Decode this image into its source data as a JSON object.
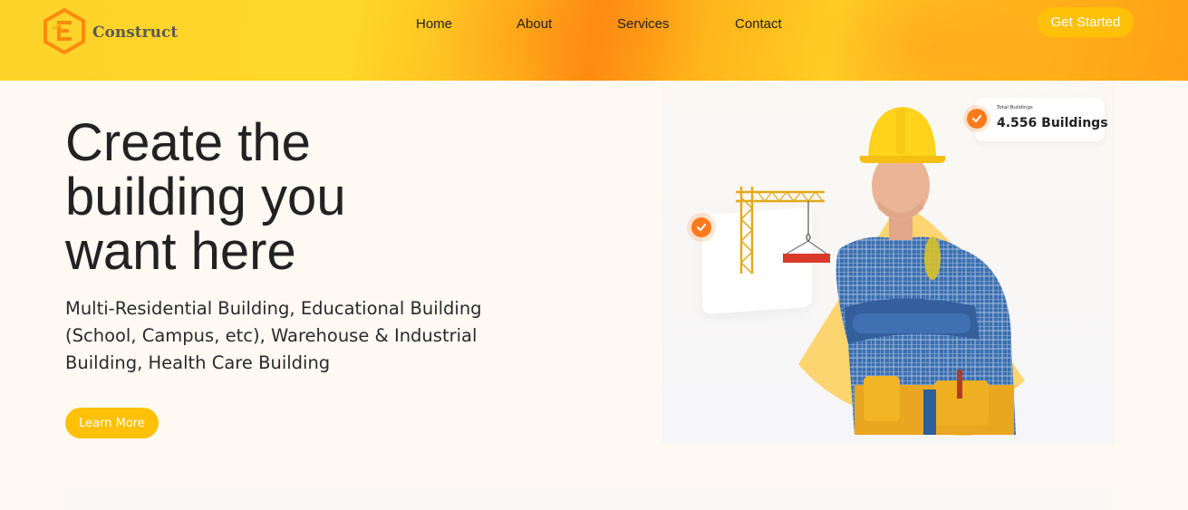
{
  "brand": {
    "name": "Construct",
    "accent": "#ffc107",
    "orange": "#ff7a1a"
  },
  "nav": {
    "items": [
      "Home",
      "About",
      "Services",
      "Contact"
    ],
    "cta": "Get Started"
  },
  "hero": {
    "title_lines": [
      "Create the",
      "building you",
      "want here"
    ],
    "description": "Multi-Residential Building, Educational Building (School, Campus, etc), Warehouse & Industrial Building, Health Care Building",
    "cta": "Learn More"
  },
  "stat": {
    "label": "Total Buildings",
    "value": "4.556 Buildings"
  },
  "icons": {
    "check": "check-icon",
    "logo": "construct-logo-icon",
    "crane": "crane-illustration"
  }
}
